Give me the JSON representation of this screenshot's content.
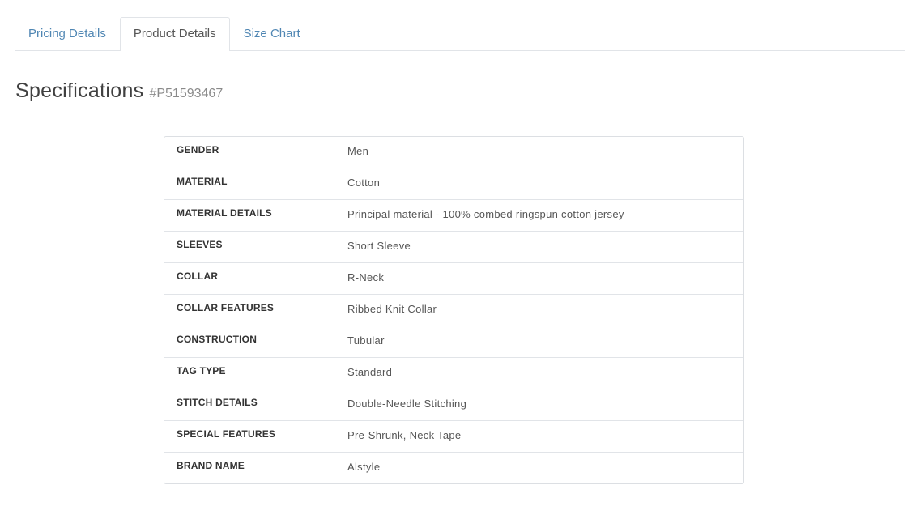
{
  "tabs": [
    {
      "label": "Pricing Details",
      "active": false
    },
    {
      "label": "Product Details",
      "active": true
    },
    {
      "label": "Size Chart",
      "active": false
    }
  ],
  "specifications": {
    "title": "Specifications",
    "code": "#P51593467",
    "rows": [
      {
        "label": "GENDER",
        "value": "Men"
      },
      {
        "label": "MATERIAL",
        "value": "Cotton"
      },
      {
        "label": "MATERIAL DETAILS",
        "value": "Principal material - 100% combed ringspun cotton jersey"
      },
      {
        "label": "SLEEVES",
        "value": "Short Sleeve"
      },
      {
        "label": "COLLAR",
        "value": "R-Neck"
      },
      {
        "label": "COLLAR FEATURES",
        "value": "Ribbed Knit Collar"
      },
      {
        "label": "CONSTRUCTION",
        "value": "Tubular"
      },
      {
        "label": "TAG TYPE",
        "value": "Standard"
      },
      {
        "label": "STITCH DETAILS",
        "value": "Double-Needle Stitching"
      },
      {
        "label": "SPECIAL FEATURES",
        "value": "Pre-Shrunk, Neck Tape"
      },
      {
        "label": "BRAND NAME",
        "value": "Alstyle"
      }
    ]
  },
  "colors": {
    "link": "#4f86b3",
    "border": "#e1e4e8"
  }
}
